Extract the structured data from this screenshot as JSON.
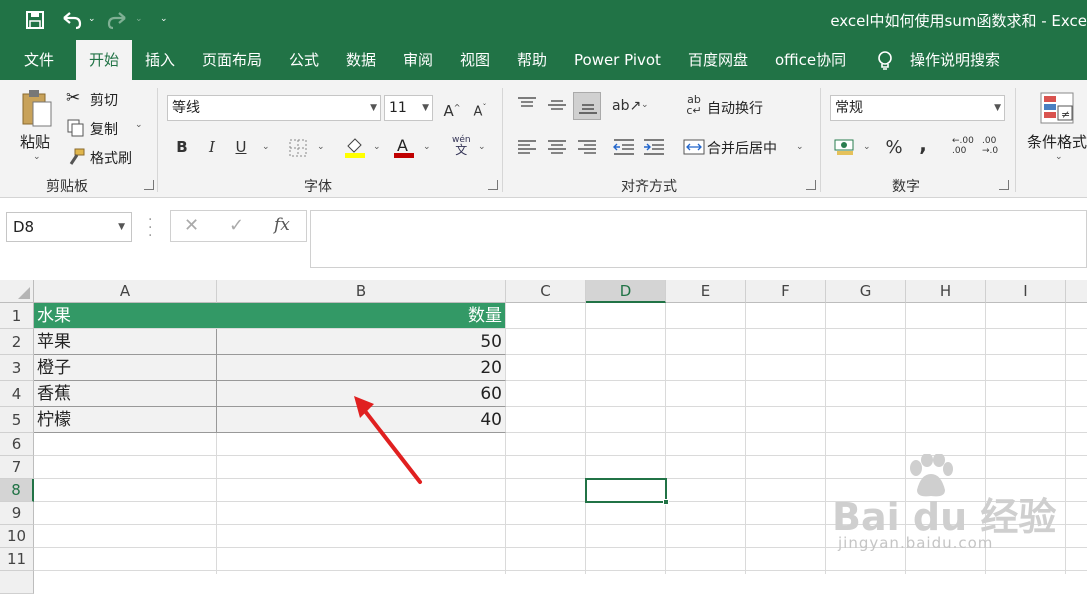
{
  "title_bar": {
    "title": "excel中如何使用sum函数求和  -  Exce",
    "save_icon": "save-icon",
    "undo_icon": "undo-icon",
    "redo_icon": "redo-icon",
    "brand_color": "#217346"
  },
  "tabs": [
    {
      "label": "文件"
    },
    {
      "label": "开始"
    },
    {
      "label": "插入"
    },
    {
      "label": "页面布局"
    },
    {
      "label": "公式"
    },
    {
      "label": "数据"
    },
    {
      "label": "审阅"
    },
    {
      "label": "视图"
    },
    {
      "label": "帮助"
    },
    {
      "label": "Power Pivot"
    },
    {
      "label": "百度网盘"
    },
    {
      "label": "office协同"
    },
    {
      "label": "操作说明搜索"
    }
  ],
  "ribbon": {
    "clipboard": {
      "paste": "粘贴",
      "cut": "剪切",
      "copy": "复制",
      "format_painter": "格式刷",
      "group": "剪贴板"
    },
    "font": {
      "name": "等线",
      "size": "11",
      "bold": "B",
      "italic": "I",
      "underline": "U",
      "group": "字体",
      "wen": "wén",
      "wen_char": "文"
    },
    "alignment": {
      "wrap": "自动换行",
      "merge": "合并后居中",
      "group": "对齐方式"
    },
    "number": {
      "format": "常规",
      "percent": "%",
      "comma": ",",
      "inc_dec": ".00",
      "dec_dec": ".00",
      "group": "数字"
    },
    "styles": {
      "conditional": "条件格式"
    }
  },
  "formula_bar": {
    "name_box": "D8",
    "cancel": "✕",
    "enter": "✓",
    "fx": "fx",
    "content": ""
  },
  "sheet": {
    "columns": [
      "A",
      "B",
      "C",
      "D",
      "E",
      "F",
      "G",
      "H",
      "I"
    ],
    "rows": [
      "1",
      "2",
      "3",
      "4",
      "5",
      "6",
      "7",
      "8",
      "9",
      "10",
      "11"
    ],
    "header_row": {
      "a": "水果",
      "b": "数量"
    },
    "data": [
      {
        "fruit": "苹果",
        "qty": "50"
      },
      {
        "fruit": "橙子",
        "qty": "20"
      },
      {
        "fruit": "香蕉",
        "qty": "60"
      },
      {
        "fruit": "柠檬",
        "qty": "40"
      }
    ],
    "selected_cell": "D8",
    "header_fill": "#339966"
  },
  "watermark": {
    "brand": "Bai du 经验",
    "url": "jingyan.baidu.com"
  }
}
